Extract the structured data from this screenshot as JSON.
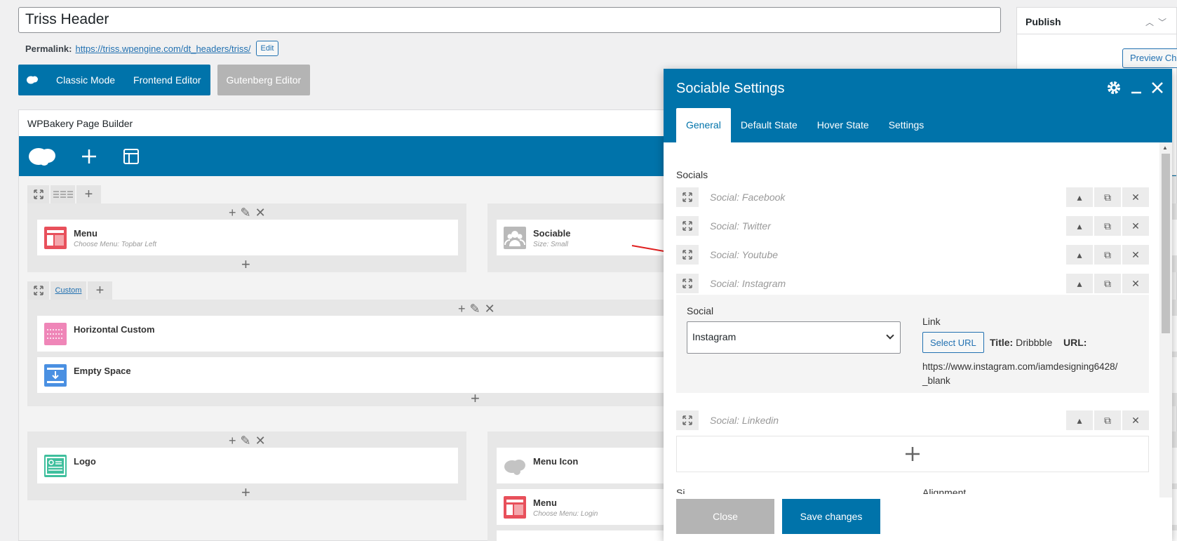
{
  "post": {
    "title": "Triss Header",
    "permalink_label": "Permalink:",
    "permalink_url": "https://triss.wpengine.com/dt_headers/triss/",
    "edit_label": "Edit"
  },
  "modes": {
    "classic": "Classic Mode",
    "frontend": "Frontend Editor",
    "gutenberg": "Gutenberg Editor"
  },
  "builder": {
    "title": "WPBakery Page Builder",
    "rows": [
      {
        "tab_label": "Custom"
      }
    ],
    "elements": {
      "menu1": {
        "name": "Menu",
        "sub": "Choose Menu: Topbar Left"
      },
      "sociable": {
        "name": "Sociable",
        "sub": "Size: Small"
      },
      "horizontal_custom": {
        "name": "Horizontal Custom"
      },
      "empty_space": {
        "name": "Empty Space"
      },
      "logo": {
        "name": "Logo"
      },
      "menu_icon": {
        "name": "Menu Icon"
      },
      "menu2": {
        "name": "Menu",
        "sub": "Choose Menu: Login"
      }
    }
  },
  "publish": {
    "title": "Publish",
    "preview_label": "Preview Cha"
  },
  "modal": {
    "title": "Sociable Settings",
    "tabs": [
      "General",
      "Default State",
      "Hover State",
      "Settings"
    ],
    "socials_label": "Socials",
    "socials": [
      "Social: Facebook",
      "Social: Twitter",
      "Social: Youtube",
      "Social: Instagram",
      "Social: Linkedin"
    ],
    "expanded": {
      "social_label": "Social",
      "social_value": "Instagram",
      "link_label": "Link",
      "select_url": "Select URL",
      "title_label": "Title:",
      "title_value": "Dribbble",
      "url_label": "URL:",
      "url_value": "https://www.instagram.com/iamdesigning6428/",
      "target_value": "_blank"
    },
    "cut_labels": {
      "left": "Si",
      "right": "Alignment"
    },
    "close_label": "Close",
    "save_label": "Save changes"
  },
  "colors": {
    "wp_blue": "#0073aa",
    "menu_red": "#e8505b",
    "custom_pink": "#ef86b8",
    "space_blue": "#4a90e2",
    "logo_green": "#3fbf9d",
    "arrow_red": "#e02020"
  }
}
